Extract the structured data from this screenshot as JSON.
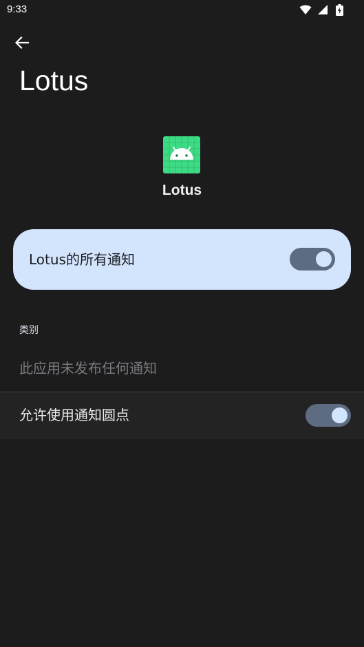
{
  "status_bar": {
    "time": "9:33",
    "icons": [
      "wifi-icon",
      "cellular-signal-icon",
      "battery-charging-icon"
    ]
  },
  "header": {
    "back_icon": "arrow-left-icon",
    "title": "Lotus"
  },
  "app": {
    "icon": "android-app-icon",
    "name": "Lotus",
    "icon_color": "#3ddc84"
  },
  "main_toggle": {
    "label": "Lotus的所有通知",
    "checked": true
  },
  "categories": {
    "header": "类别",
    "empty_text": "此应用未发布任何通知"
  },
  "dot_setting": {
    "label": "允许使用通知圆点",
    "checked": true
  },
  "colors": {
    "background": "#1c1c1d",
    "card": "#d3e4fd",
    "switch_track": "#5d6c80"
  }
}
